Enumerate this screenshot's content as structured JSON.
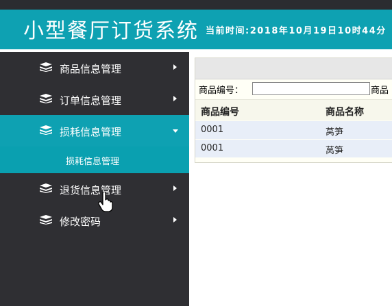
{
  "header": {
    "app_title": "小型餐厅订货系统",
    "clock": "当前时间:2018年10月19日10时44分"
  },
  "sidebar": {
    "items": [
      {
        "label": "商品信息管理",
        "icon": "stack-icon",
        "expanded": false
      },
      {
        "label": "订单信息管理",
        "icon": "stack-icon",
        "expanded": false
      },
      {
        "label": "损耗信息管理",
        "icon": "stack-icon",
        "expanded": true,
        "sub_items": [
          {
            "label": "损耗信息管理"
          }
        ]
      },
      {
        "label": "退货信息管理",
        "icon": "stack-icon",
        "expanded": false
      },
      {
        "label": "修改密码",
        "icon": "stack-icon",
        "expanded": false
      }
    ]
  },
  "main": {
    "search": {
      "label": "商品编号：",
      "value": "",
      "label2": "商品"
    },
    "table": {
      "columns": [
        "商品编号",
        "商品名称"
      ],
      "rows": [
        [
          "0001",
          "莴笋"
        ],
        [
          "0001",
          "莴笋"
        ]
      ]
    }
  },
  "colors": {
    "accent": "#0ea1b2",
    "sidebar_bg": "#2f2f33",
    "row_bg": "#e8eef8"
  }
}
